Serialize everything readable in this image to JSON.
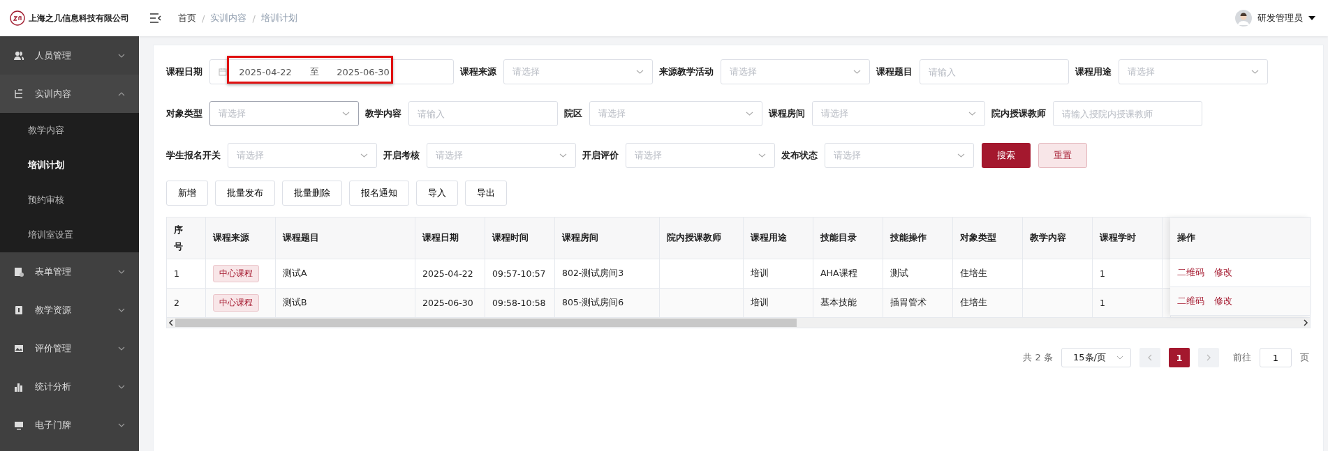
{
  "header": {
    "company": "上海之几信息科技有限公司",
    "breadcrumb": [
      "首页",
      "实训内容",
      "培训计划"
    ],
    "breadcrumb_separators": [
      "/",
      "/"
    ],
    "user": "研发管理员"
  },
  "sidebar": {
    "items": [
      {
        "label": "人员管理",
        "expanded": false
      },
      {
        "label": "实训内容",
        "expanded": true,
        "children": [
          {
            "label": "教学内容",
            "selected": false
          },
          {
            "label": "培训计划",
            "selected": true
          },
          {
            "label": "预约审核",
            "selected": false
          },
          {
            "label": "培训室设置",
            "selected": false
          }
        ]
      },
      {
        "label": "表单管理",
        "expanded": false
      },
      {
        "label": "教学资源",
        "expanded": false
      },
      {
        "label": "评价管理",
        "expanded": false
      },
      {
        "label": "统计分析",
        "expanded": false
      },
      {
        "label": "电子门牌",
        "expanded": false
      }
    ]
  },
  "filters": [
    [
      {
        "label": "课程日期",
        "kind": "date",
        "start": "2025-04-22",
        "separator": "至",
        "end": "2025-06-30",
        "highlighted": true
      },
      {
        "label": "课程来源",
        "kind": "select",
        "placeholder": "请选择"
      },
      {
        "label": "来源教学活动",
        "kind": "select",
        "placeholder": "请选择"
      },
      {
        "label": "课程题目",
        "kind": "input",
        "placeholder": "请输入"
      },
      {
        "label": "课程用途",
        "kind": "select",
        "placeholder": "请选择"
      }
    ],
    [
      {
        "label": "对象类型",
        "kind": "select",
        "placeholder": "请选择",
        "focused": true
      },
      {
        "label": "教学内容",
        "kind": "input",
        "placeholder": "请输入"
      },
      {
        "label": "院区",
        "kind": "select",
        "placeholder": "请选择"
      },
      {
        "label": "课程房间",
        "kind": "select",
        "placeholder": "请选择"
      },
      {
        "label": "院内授课教师",
        "kind": "input",
        "placeholder": "请输入授院内授课教师"
      }
    ],
    [
      {
        "label": "学生报名开关",
        "kind": "select",
        "placeholder": "请选择"
      },
      {
        "label": "开启考核",
        "kind": "select",
        "placeholder": "请选择"
      },
      {
        "label": "开启评价",
        "kind": "select",
        "placeholder": "请选择"
      },
      {
        "label": "发布状态",
        "kind": "select",
        "placeholder": "请选择"
      }
    ]
  ],
  "search_buttons": [
    {
      "label": "搜索",
      "kind": "primary"
    },
    {
      "label": "重置",
      "kind": "plain"
    }
  ],
  "actions": [
    "新增",
    "批量发布",
    "批量删除",
    "报名通知",
    "导入",
    "导出"
  ],
  "table": {
    "columns": [
      "序号",
      "课程来源",
      "课程题目",
      "课程日期",
      "课程时间",
      "课程房间",
      "院内授课教师",
      "课程用途",
      "技能目录",
      "技能操作",
      "对象类型",
      "教学内容",
      "课程学时",
      "操作"
    ],
    "rows": [
      {
        "cells": [
          "1",
          "中心课程",
          "测试A",
          "2025-04-22",
          "09:57-10:57",
          "802-测试房间3",
          null,
          "培训",
          "AHA课程",
          "测试",
          "住培生",
          null,
          "1"
        ],
        "links": [
          "二维码",
          "修改"
        ]
      },
      {
        "cells": [
          "2",
          "中心课程",
          "测试B",
          "2025-06-30",
          "09:58-10:58",
          "805-测试房间6",
          null,
          "培训",
          "基本技能",
          "插胃管术",
          "住培生",
          null,
          "1"
        ],
        "links": [
          "二维码",
          "修改"
        ]
      }
    ]
  },
  "pagination": {
    "total": "共 2 条",
    "page_size": "15条/页",
    "pages": [
      {
        "label": "1",
        "selected": true
      }
    ],
    "goto": "前往",
    "goto_value": "1",
    "goto_suffix": "页"
  }
}
